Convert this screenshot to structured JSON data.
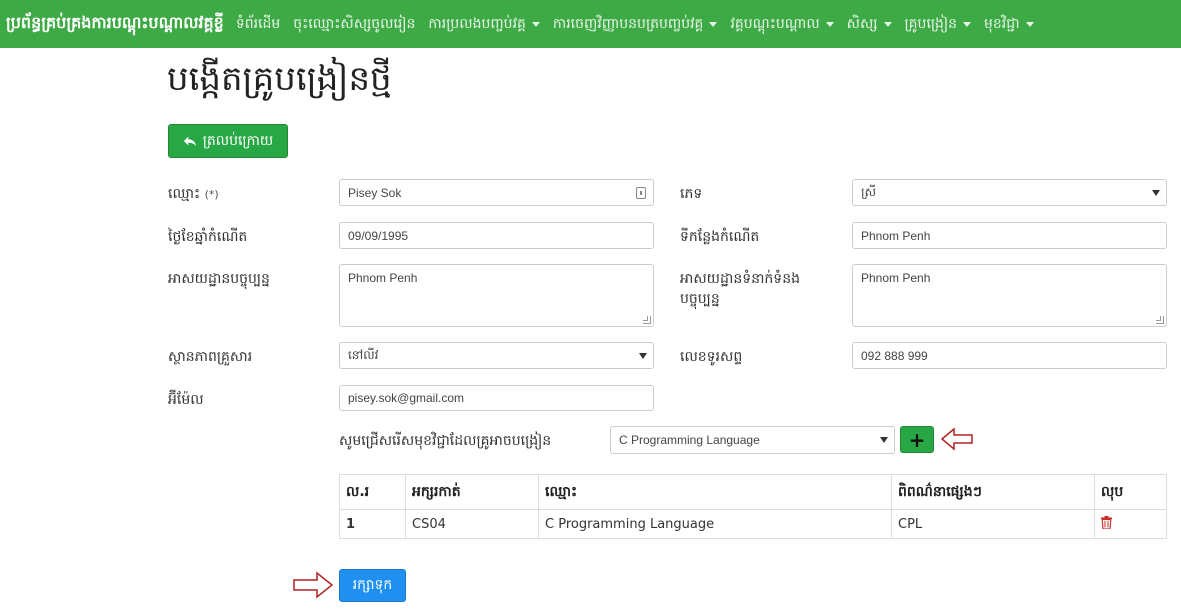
{
  "navbar": {
    "brand": "ប្រព័ន្ធគ្រប់គ្រងការបណ្តុះបណ្តាលវគ្គខ្លី",
    "items": [
      {
        "label": "ទំព័រដើម",
        "has_caret": false
      },
      {
        "label": "ចុះឈ្មោះសិស្សចូលរៀន",
        "has_caret": false
      },
      {
        "label": "ការប្រលងបញ្ចប់វគ្គ",
        "has_caret": true
      },
      {
        "label": "ការចេញវិញ្ញាបនបត្របញ្ចប់វគ្គ",
        "has_caret": true
      },
      {
        "label": "វគ្គបណ្តុះបណ្តាល",
        "has_caret": true
      },
      {
        "label": "សិស្ស",
        "has_caret": true
      },
      {
        "label": "គ្រូបង្រៀន",
        "has_caret": true
      },
      {
        "label": "មុខវិជ្ជា",
        "has_caret": true
      }
    ]
  },
  "page": {
    "title": "បង្កើតគ្រូបង្រៀនថ្មី",
    "back_button": "ត្រលប់ក្រោយ",
    "save_button": "រក្សាទុក"
  },
  "form": {
    "name_label": "ឈ្មោះ",
    "name_required": "(*)",
    "name_value": "Pisey Sok",
    "gender_label": "ភេទ",
    "gender_value": "ស្រី",
    "dob_label": "ថ្ងៃខែឆ្នាំកំណើត",
    "dob_value": "09/09/1995",
    "birthplace_label": "ទីកន្លែងកំណើត",
    "birthplace_value": "Phnom Penh",
    "address_label": "អាសយដ្ឋានបច្ចុប្បន្ន",
    "address_value": "Phnom Penh",
    "contact_address_label": "អាសយដ្ឋានទំនាក់ទំនង បច្ចុប្បន្ន",
    "contact_address_value": "Phnom Penh",
    "marital_label": "ស្ថានភាពគ្រួសារ",
    "marital_value": "នៅលីវ",
    "phone_label": "លេខទូរសព្ទ",
    "phone_value": "092 888 999",
    "email_label": "អ៊ីម៉ែល",
    "email_value": "pisey.sok@gmail.com",
    "subject_select_label": "សូមជ្រើសរើសមុខវិជ្ជាដែលគ្រូអាចបង្រៀន",
    "subject_select_value": "C Programming Language",
    "add_button": "+"
  },
  "table": {
    "headers": [
      "ល.រ",
      "អក្សរកាត់",
      "ឈ្មោះ",
      "ពិពណ៌នាផ្សេងៗ",
      "លុប"
    ],
    "rows": [
      {
        "no": "1",
        "code": "CS04",
        "name": "C Programming Language",
        "description": "CPL"
      }
    ]
  },
  "icons": {
    "back": "reply-arrow-icon",
    "delete": "trash-icon",
    "annotation": "outline-arrow-icon"
  },
  "colors": {
    "navbar": "#3eaa45",
    "primary_button": "#1f8ff0",
    "success_button": "#28a745",
    "delete_icon": "#c9302c",
    "annotation_arrow": "#b22222"
  }
}
